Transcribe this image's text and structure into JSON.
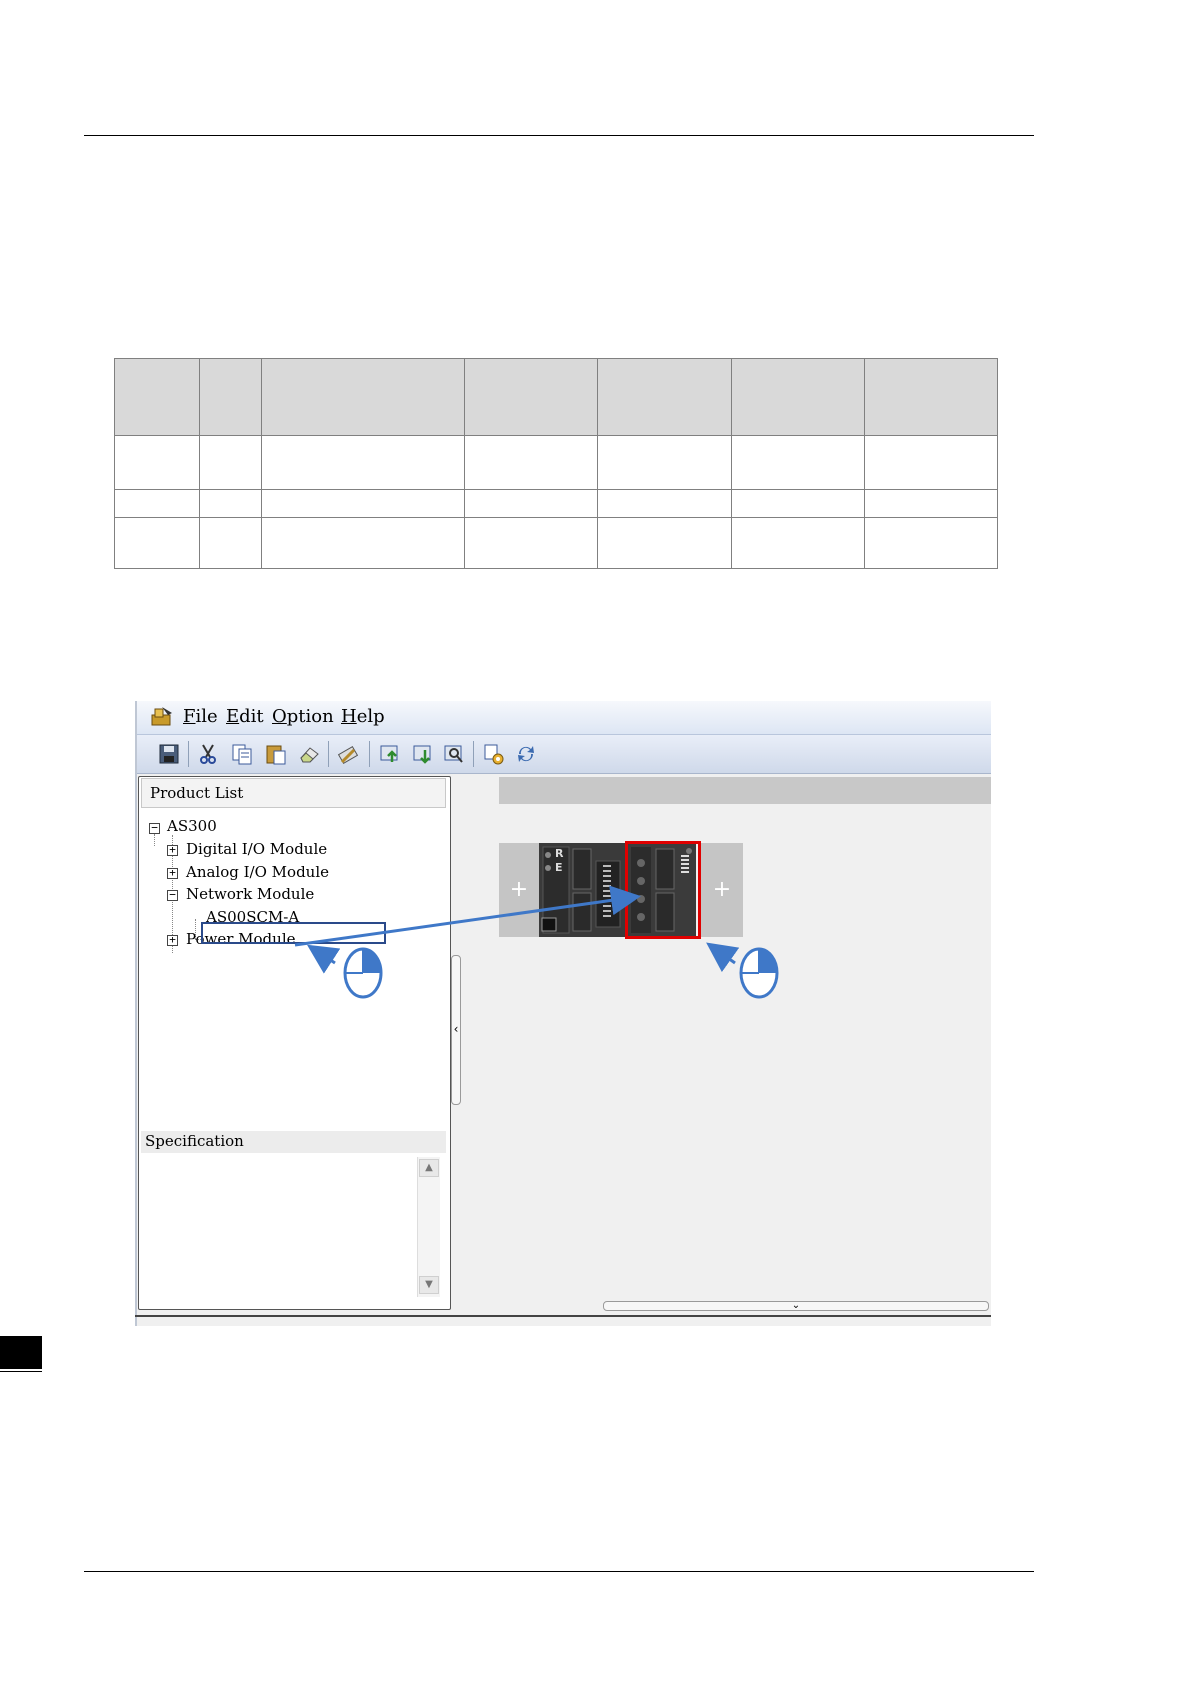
{
  "window": {
    "menu": {
      "file": "File",
      "edit": "Edit",
      "option": "Option",
      "help": "Help"
    },
    "toolbar_icons": [
      "save-icon",
      "cut-icon",
      "copy-icon",
      "paste-icon",
      "eraser-icon",
      "edit-icon",
      "upload-icon",
      "download-icon",
      "scan-icon",
      "settings-icon",
      "sync-icon"
    ],
    "product_list": {
      "header": "Product List",
      "root": "AS300",
      "items": [
        {
          "label": "Digital I/O Module",
          "expander": "+"
        },
        {
          "label": "Analog I/O Module",
          "expander": "+"
        },
        {
          "label": "Network Module",
          "expander": "−"
        },
        {
          "label": "AS00SCM-A",
          "expander": ""
        },
        {
          "label": "Power Module",
          "expander": "+"
        }
      ]
    },
    "specification": {
      "header": "Specification"
    },
    "rack": {
      "left_slot_symbol": "+",
      "right_slot_symbol": "+",
      "cpu_letters": [
        "R",
        "E"
      ],
      "highlight_color": "#e00000"
    },
    "accent_color": "#3f78c8"
  }
}
